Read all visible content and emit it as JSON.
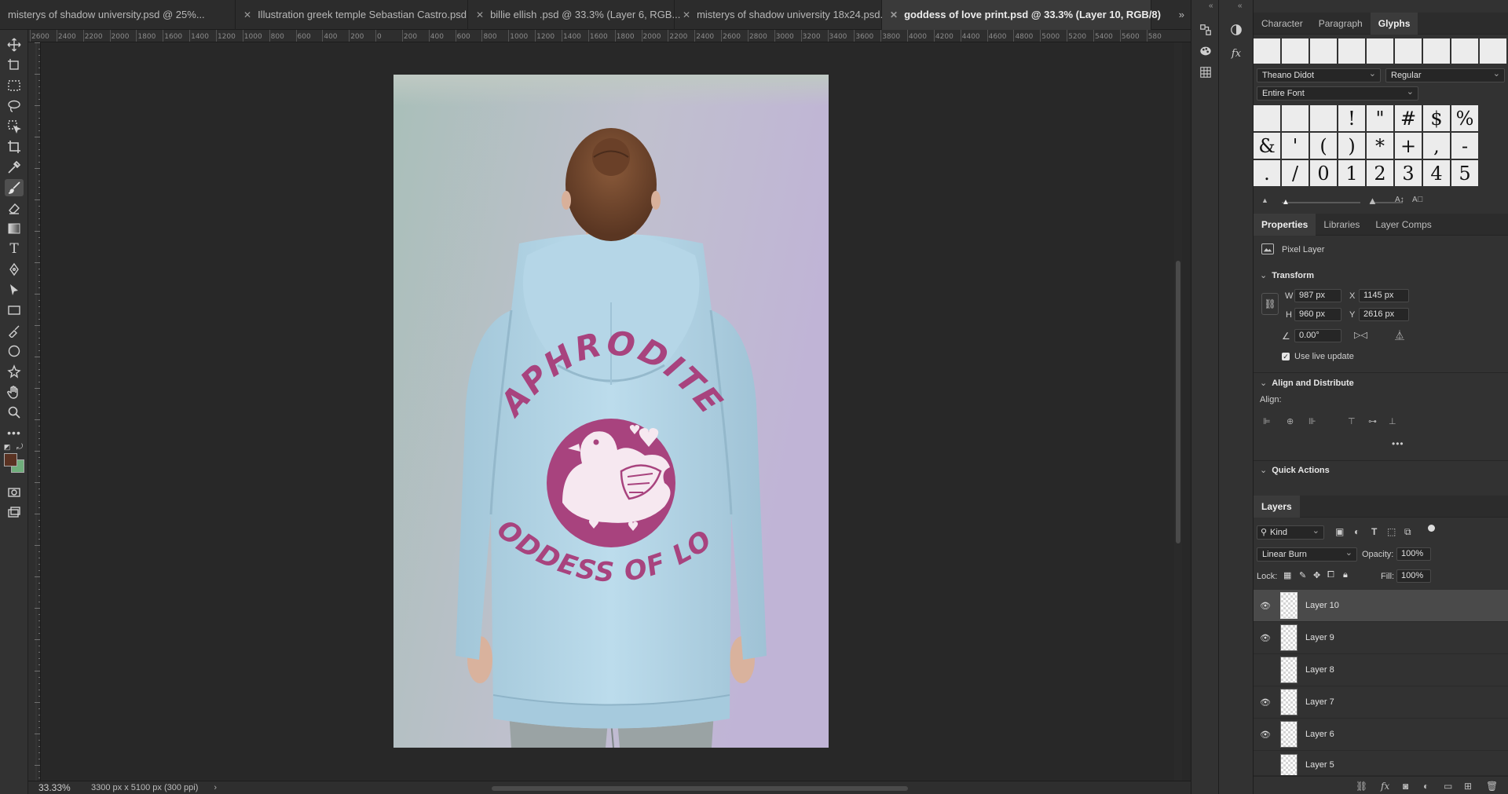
{
  "tabs": [
    {
      "label": "misterys of shadow university.psd @ 25%...",
      "active": false
    },
    {
      "label": "Illustration greek temple Sebastian Castro.psd",
      "active": false
    },
    {
      "label": "billie ellish .psd @ 33.3% (Layer 6, RGB...",
      "active": false
    },
    {
      "label": "misterys of shadow university 18x24.psd...",
      "active": false
    },
    {
      "label": "goddess of love print.psd @ 33.3% (Layer 10, RGB/8)",
      "active": true
    }
  ],
  "ruler_top": [
    "2600",
    "2400",
    "2200",
    "2000",
    "1800",
    "1600",
    "1400",
    "1200",
    "1000",
    "800",
    "600",
    "400",
    "200",
    "0",
    "200",
    "400",
    "600",
    "800",
    "1000",
    "1200",
    "1400",
    "1600",
    "1800",
    "2000",
    "2200",
    "2400",
    "2600",
    "2800",
    "3000",
    "3200",
    "3400",
    "3600",
    "3800",
    "4000",
    "4200",
    "4400",
    "4600",
    "4800",
    "5000",
    "5200",
    "5400",
    "5600",
    "580"
  ],
  "artwork": {
    "top_text": "APHRODITE",
    "bottom_text": "GODDESS OF LOVE",
    "print_color": "#a8437e",
    "hoodie_color": "#b6d7e8"
  },
  "colors": {
    "foreground": "#5a3222",
    "background": "#6fae7b"
  },
  "status": {
    "zoom": "33.33%",
    "doc_size": "3300 px x 5100 px (300 ppi)"
  },
  "glyphs_panel": {
    "tabs": [
      "Character",
      "Paragraph",
      "Glyphs"
    ],
    "font": "Theano Didot",
    "style": "Regular",
    "subset": "Entire Font",
    "cells": [
      "",
      "",
      "",
      "!",
      "\"",
      "#",
      "$",
      "%",
      "&",
      "'",
      "(",
      ")",
      "*",
      "+",
      ",",
      "-",
      ".",
      "/",
      "0",
      "1",
      "2",
      "3",
      "4",
      "5"
    ]
  },
  "properties_panel": {
    "tabs": [
      "Properties",
      "Libraries",
      "Layer Comps"
    ],
    "layer_type": "Pixel Layer",
    "transform_title": "Transform",
    "w_label": "W",
    "w": "987 px",
    "h_label": "H",
    "h": "960 px",
    "x_label": "X",
    "x": "1145 px",
    "y_label": "Y",
    "y": "2616 px",
    "angle": "0.00°",
    "live_update": "Use live update",
    "align_title": "Align and Distribute",
    "align_label": "Align:",
    "quick_actions": "Quick Actions"
  },
  "layers_panel": {
    "tab": "Layers",
    "filter": "Kind",
    "blend_mode": "Linear Burn",
    "opacity_label": "Opacity:",
    "opacity": "100%",
    "lock_label": "Lock:",
    "fill_label": "Fill:",
    "fill": "100%",
    "layers": [
      {
        "name": "Layer 10",
        "visible": true,
        "selected": true
      },
      {
        "name": "Layer 9",
        "visible": true,
        "selected": false
      },
      {
        "name": "Layer 8",
        "visible": false,
        "selected": false
      },
      {
        "name": "Layer 7",
        "visible": true,
        "selected": false
      },
      {
        "name": "Layer 6",
        "visible": true,
        "selected": false
      },
      {
        "name": "Layer 5",
        "visible": false,
        "selected": false
      }
    ]
  }
}
